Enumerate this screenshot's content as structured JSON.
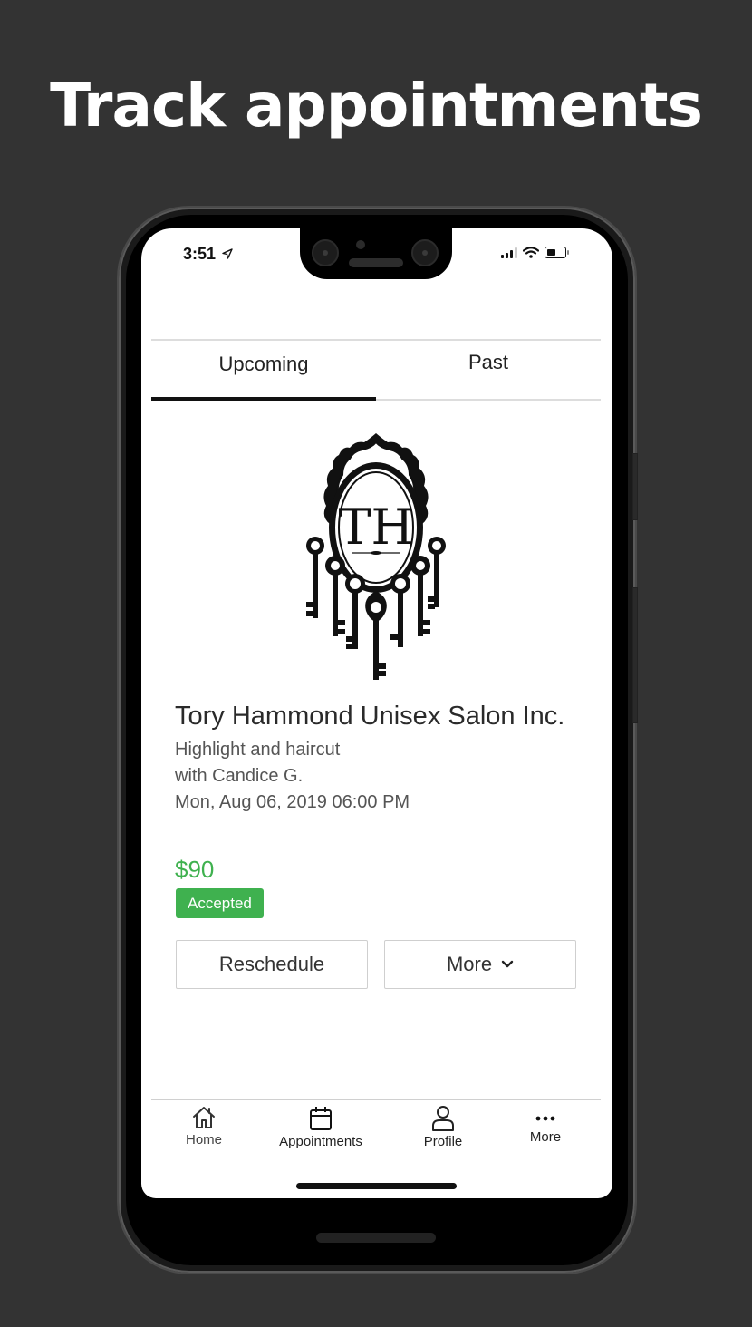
{
  "headline": "Track appointments",
  "status_bar": {
    "time": "3:51",
    "location_icon": "location-arrow-icon",
    "signal_icon": "cellular-signal-icon",
    "wifi_icon": "wifi-icon",
    "battery_icon": "battery-icon"
  },
  "tabs": [
    {
      "label": "Upcoming",
      "active": true
    },
    {
      "label": "Past",
      "active": false
    }
  ],
  "appointment": {
    "logo_monogram": "TH",
    "business_name": "Tory Hammond Unisex Salon Inc.",
    "service": "Highlight and haircut",
    "staff": "with Candice G.",
    "datetime": "Mon, Aug 06, 2019 06:00 PM",
    "price": "$90",
    "status": "Accepted",
    "colors": {
      "price": "#3fb14f",
      "status_badge": "#3fb14f"
    },
    "actions": {
      "reschedule_label": "Reschedule",
      "more_label": "More",
      "more_icon": "chevron-down-icon"
    }
  },
  "bottom_nav": [
    {
      "label": "Home",
      "icon": "home-icon"
    },
    {
      "label": "Appointments",
      "icon": "calendar-icon"
    },
    {
      "label": "Profile",
      "icon": "person-icon"
    },
    {
      "label": "More",
      "icon": "more-dots-icon"
    }
  ]
}
